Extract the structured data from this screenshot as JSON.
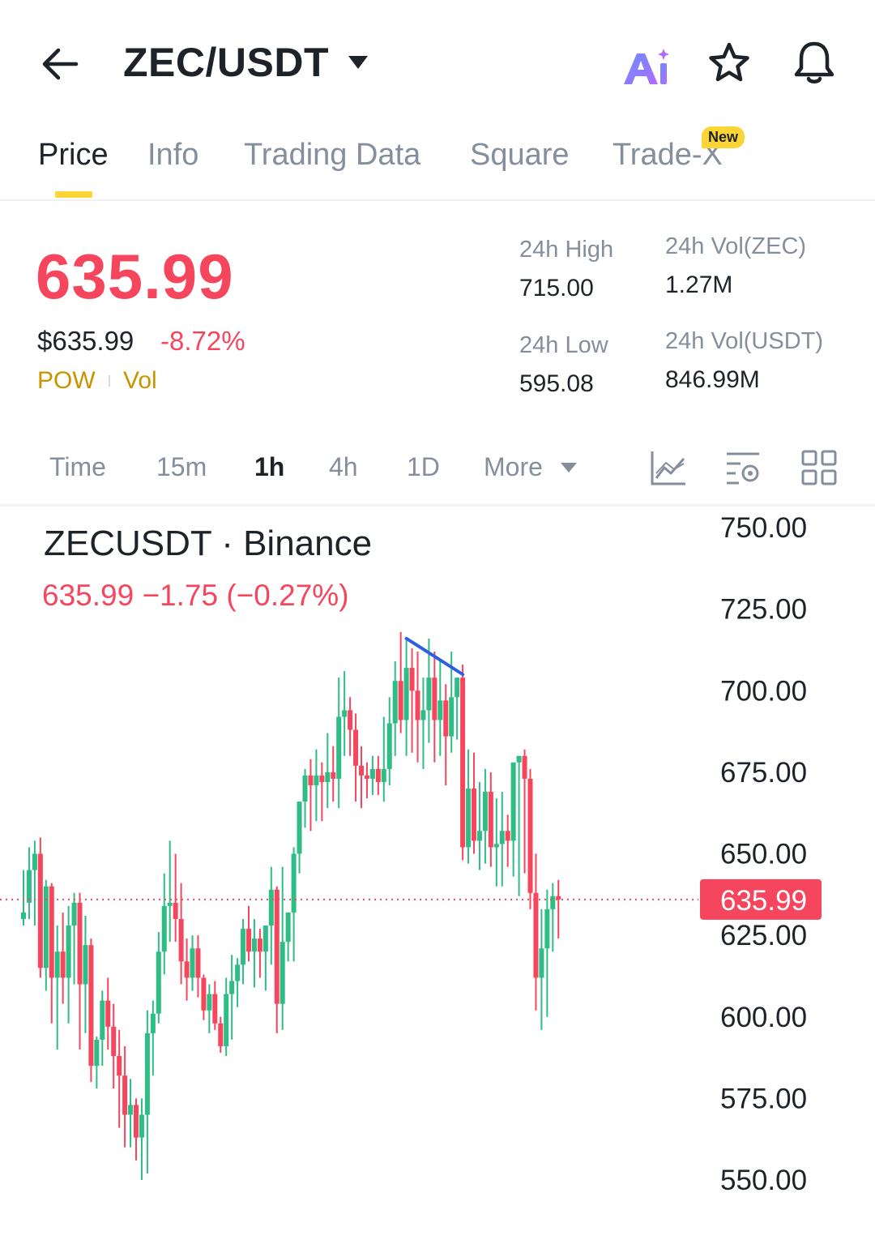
{
  "header": {
    "back_icon": "arrow-left-icon",
    "pair": "ZEC/USDT",
    "dropdown_icon": "caret-down-icon",
    "ai_icon": "ai-assistant-icon",
    "favorite_icon": "star-icon",
    "alert_icon": "bell-icon"
  },
  "tabs": [
    {
      "label": "Price",
      "active": true
    },
    {
      "label": "Info"
    },
    {
      "label": "Trading Data"
    },
    {
      "label": "Square"
    },
    {
      "label": "Trade-X",
      "badge": "New"
    }
  ],
  "ticker": {
    "last_price": "635.99",
    "usd_price": "$635.99",
    "change_pct": "-8.72%",
    "tags": [
      "POW",
      "Vol"
    ],
    "high_label": "24h High",
    "high_value": "715.00",
    "low_label": "24h Low",
    "low_value": "595.08",
    "vol_base_label": "24h Vol(ZEC)",
    "vol_base_value": "1.27M",
    "vol_quote_label": "24h Vol(USDT)",
    "vol_quote_value": "846.99M"
  },
  "timeframes": {
    "items": [
      "Time",
      "15m",
      "1h",
      "4h",
      "1D"
    ],
    "active": "1h",
    "more_label": "More",
    "tools": [
      "indicator-chart-icon",
      "chart-settings-icon",
      "grid-layout-icon"
    ]
  },
  "chart_header": {
    "title": "ZECUSDT · Binance",
    "subtitle": "635.99  −1.75 (−0.27%)"
  },
  "chart_data": {
    "type": "candlestick",
    "y_ticks": [
      "750.00",
      "725.00",
      "700.00",
      "675.00",
      "650.00",
      "625.00",
      "600.00",
      "575.00",
      "550.00"
    ],
    "ylim": [
      545,
      755
    ],
    "last_price_label": "635.99",
    "last_price": 635.99,
    "colors": {
      "up": "#2ebd85",
      "down": "#f6465d",
      "trendline": "#2f5fe0"
    },
    "trendline": {
      "from": {
        "candle": 68,
        "price": 716
      },
      "to": {
        "candle": 78,
        "price": 705
      }
    },
    "candles": [
      [
        630,
        645,
        628,
        632
      ],
      [
        635,
        652,
        630,
        645
      ],
      [
        645,
        654,
        628,
        650
      ],
      [
        650,
        655,
        612,
        615
      ],
      [
        615,
        642,
        608,
        640
      ],
      [
        640,
        641,
        598,
        612
      ],
      [
        612,
        628,
        590,
        620
      ],
      [
        620,
        632,
        604,
        612
      ],
      [
        612,
        634,
        598,
        628
      ],
      [
        628,
        638,
        610,
        635
      ],
      [
        635,
        638,
        590,
        610
      ],
      [
        610,
        631,
        595,
        622
      ],
      [
        622,
        624,
        580,
        585
      ],
      [
        585,
        594,
        578,
        593
      ],
      [
        593,
        608,
        585,
        605
      ],
      [
        605,
        612,
        590,
        597
      ],
      [
        597,
        604,
        578,
        588
      ],
      [
        588,
        596,
        566,
        582
      ],
      [
        582,
        591,
        560,
        570
      ],
      [
        570,
        581,
        560,
        573
      ],
      [
        573,
        575,
        556,
        563
      ],
      [
        563,
        575,
        550,
        570
      ],
      [
        570,
        602,
        552,
        595
      ],
      [
        595,
        605,
        582,
        601
      ],
      [
        601,
        626,
        598,
        620
      ],
      [
        620,
        644,
        613,
        634
      ],
      [
        634,
        654,
        623,
        635
      ],
      [
        635,
        650,
        623,
        630
      ],
      [
        630,
        641,
        610,
        617
      ],
      [
        617,
        624,
        605,
        612
      ],
      [
        612,
        625,
        608,
        621
      ],
      [
        621,
        625,
        606,
        612
      ],
      [
        612,
        613,
        599,
        602
      ],
      [
        602,
        610,
        595,
        607
      ],
      [
        607,
        611,
        596,
        598
      ],
      [
        598,
        600,
        589,
        591
      ],
      [
        591,
        612,
        588,
        607
      ],
      [
        607,
        619,
        593,
        611
      ],
      [
        611,
        618,
        603,
        616
      ],
      [
        616,
        630,
        610,
        627
      ],
      [
        627,
        634,
        617,
        620
      ],
      [
        620,
        630,
        609,
        624
      ],
      [
        624,
        627,
        612,
        620
      ],
      [
        620,
        628,
        608,
        628
      ],
      [
        628,
        646,
        616,
        639
      ],
      [
        639,
        640,
        595,
        604
      ],
      [
        604,
        646,
        596,
        623
      ],
      [
        623,
        632,
        617,
        632
      ],
      [
        632,
        652,
        617,
        650
      ],
      [
        650,
        660,
        644,
        666
      ],
      [
        666,
        676,
        658,
        674
      ],
      [
        674,
        679,
        657,
        671
      ],
      [
        671,
        682,
        660,
        674
      ],
      [
        674,
        678,
        660,
        672
      ],
      [
        672,
        687,
        664,
        675
      ],
      [
        675,
        683,
        666,
        673
      ],
      [
        673,
        704,
        664,
        692
      ],
      [
        692,
        706,
        680,
        694
      ],
      [
        694,
        698,
        680,
        688
      ],
      [
        688,
        693,
        666,
        677
      ],
      [
        677,
        683,
        664,
        674
      ],
      [
        674,
        678,
        667,
        673
      ],
      [
        673,
        680,
        668,
        676
      ],
      [
        676,
        680,
        668,
        672
      ],
      [
        672,
        692,
        666,
        676
      ],
      [
        676,
        698,
        671,
        690
      ],
      [
        690,
        709,
        680,
        703
      ],
      [
        703,
        718,
        687,
        691
      ],
      [
        691,
        716,
        680,
        707
      ],
      [
        707,
        713,
        681,
        700
      ],
      [
        700,
        712,
        678,
        691
      ],
      [
        691,
        704,
        676,
        694
      ],
      [
        694,
        716,
        684,
        704
      ],
      [
        704,
        712,
        678,
        691
      ],
      [
        691,
        709,
        680,
        697
      ],
      [
        697,
        702,
        671,
        686
      ],
      [
        686,
        712,
        681,
        698
      ],
      [
        698,
        704,
        685,
        704
      ],
      [
        704,
        708,
        648,
        652
      ],
      [
        652,
        682,
        647,
        670
      ],
      [
        670,
        681,
        650,
        654
      ],
      [
        654,
        672,
        645,
        657
      ],
      [
        657,
        676,
        647,
        669
      ],
      [
        669,
        675,
        646,
        652
      ],
      [
        652,
        667,
        640,
        653
      ],
      [
        653,
        669,
        640,
        657
      ],
      [
        657,
        662,
        646,
        654
      ],
      [
        654,
        675,
        643,
        678
      ],
      [
        678,
        680,
        637,
        680
      ],
      [
        680,
        682,
        644,
        673
      ],
      [
        673,
        676,
        633,
        638
      ],
      [
        638,
        650,
        602,
        612
      ],
      [
        612,
        633,
        596,
        621
      ],
      [
        621,
        639,
        600,
        633
      ],
      [
        633,
        641,
        620,
        637
      ],
      [
        637,
        642,
        624,
        636
      ]
    ]
  }
}
